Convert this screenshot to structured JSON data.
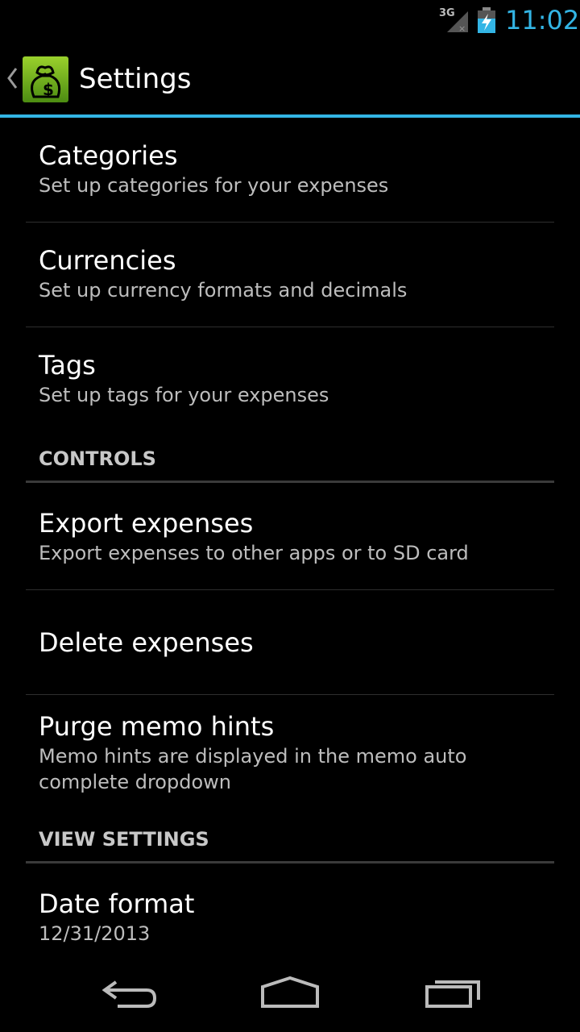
{
  "status_bar": {
    "network": "3G",
    "time": "11:02",
    "accent_color": "#33b5e5"
  },
  "action_bar": {
    "title": "Settings",
    "up_icon": "chevron-left-icon",
    "app_icon": "money-bag-icon"
  },
  "preferences": {
    "categories": {
      "title": "Categories",
      "summary": "Set up categories for your expenses"
    },
    "currencies": {
      "title": "Currencies",
      "summary": "Set up currency formats and decimals"
    },
    "tags": {
      "title": "Tags",
      "summary": "Set up tags for your expenses"
    }
  },
  "controls": {
    "header": "CONTROLS",
    "export": {
      "title": "Export expenses",
      "summary": "Export expenses to other apps or to SD card"
    },
    "delete": {
      "title": "Delete expenses"
    },
    "purge": {
      "title": "Purge memo hints",
      "summary_line1": "Memo hints are displayed in the memo auto",
      "summary_line2": "complete dropdown"
    }
  },
  "view_settings": {
    "header": "VIEW SETTINGS",
    "date_format": {
      "title": "Date format",
      "summary": "12/31/2013"
    }
  },
  "nav_bar": {
    "back_icon": "back-icon",
    "home_icon": "home-icon",
    "recents_icon": "recent-apps-icon"
  }
}
